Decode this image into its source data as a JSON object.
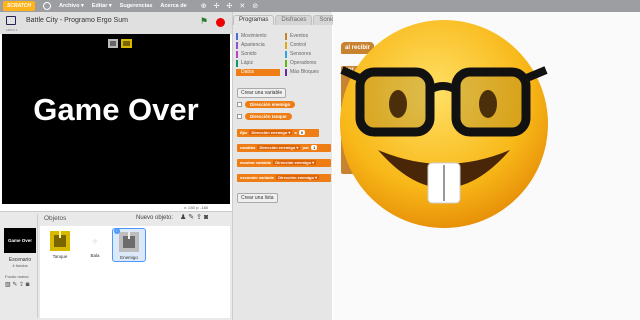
{
  "topbar": {
    "logo": "SCRATCH",
    "menus": [
      "Archivo ▾",
      "Editar ▾",
      "Sugerencias",
      "Acerca de"
    ],
    "tools": [
      "⊕",
      "✢",
      "✣",
      "✕",
      "⊘"
    ]
  },
  "stage": {
    "project_title": "Battle City - Programo Ergo Sum",
    "version": "v456.0.1",
    "game_over_text": "Game Over",
    "coords": "x: 240  y: -160"
  },
  "sprite_pane": {
    "stage_thumb_text": "Game Over",
    "stage_label": "Escenario",
    "stage_sub": "4 fondos",
    "fondo_label": "Fondo nuevo:",
    "objetos_label": "Objetos",
    "nuevo_objeto_label": "Nuevo objeto:",
    "sprites": [
      {
        "name": "Tanque",
        "selected": false
      },
      {
        "name": "Bala",
        "selected": false
      },
      {
        "name": "Enemigo",
        "selected": true,
        "badge": "i"
      }
    ]
  },
  "palette": {
    "tabs": [
      "Programas",
      "Disfraces",
      "Sonidos"
    ],
    "categories_left": [
      {
        "label": "Movimiento",
        "color": "#4a6cd4"
      },
      {
        "label": "Apariencia",
        "color": "#8a55d7"
      },
      {
        "label": "Sonido",
        "color": "#bb42c3"
      },
      {
        "label": "Lápiz",
        "color": "#0e9a6c"
      },
      {
        "label": "Datos",
        "color": "#ee7d16"
      }
    ],
    "categories_right": [
      {
        "label": "Eventos",
        "color": "#c88330"
      },
      {
        "label": "Control",
        "color": "#e1a91a"
      },
      {
        "label": "Sensores",
        "color": "#2ca5e2"
      },
      {
        "label": "Operadores",
        "color": "#5cb712"
      },
      {
        "label": "Más Bloques",
        "color": "#632d99"
      }
    ],
    "crear_variable": "Crear una variable",
    "variables": [
      "Dirección enemigo",
      "Dirección tanque"
    ],
    "blocks": [
      {
        "pre": "fijar",
        "dd": "Dirección enemigo ▾",
        "mid": "a",
        "num": "0"
      },
      {
        "pre": "cambiar",
        "dd": "Dirección enemigo ▾",
        "mid": "por",
        "num": "1"
      },
      {
        "pre": "mostrar variable",
        "dd": "Dirección enemigo ▾",
        "mid": "",
        "num": ""
      },
      {
        "pre": "esconder variable",
        "dd": "Dirección enemigo ▾",
        "mid": "",
        "num": ""
      }
    ],
    "crear_lista": "Crear una lista"
  },
  "scripts": {
    "hat_label": "al recibir",
    "c_label": "por"
  }
}
